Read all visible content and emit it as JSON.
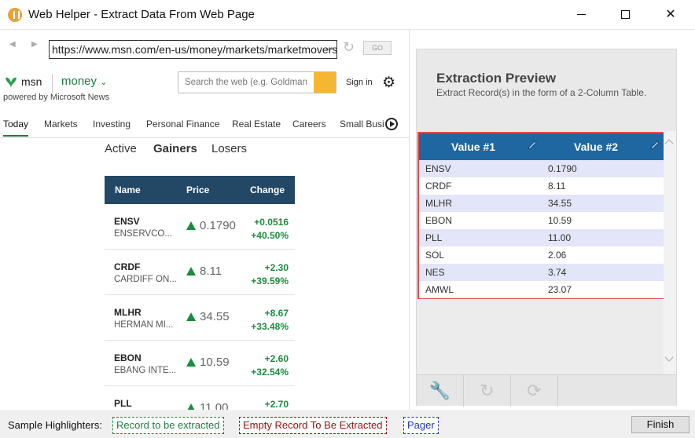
{
  "window": {
    "title": "Web Helper - Extract Data From Web Page",
    "min_label": "",
    "max_label": "",
    "close_label": "✕"
  },
  "browser": {
    "url": "https://www.msn.com/en-us/money/markets/marketmovers",
    "go_label": "GO",
    "back_icon": "left-arrow",
    "forward_icon": "right-arrow",
    "refresh_icon": "refresh"
  },
  "msn": {
    "brand": "msn",
    "section": "money",
    "powered": "powered by Microsoft News",
    "search_placeholder": "Search the web (e.g. Goldman",
    "signin": "Sign in",
    "tabs": [
      "Today",
      "Markets",
      "Investing",
      "Personal Finance",
      "Real Estate",
      "Careers",
      "Small Busi"
    ],
    "subtabs": [
      "Active",
      "Gainers",
      "Losers"
    ],
    "table": {
      "headers": [
        "Name",
        "Price",
        "Change"
      ],
      "rows": [
        {
          "symbol": "ENSV",
          "name": "ENSERVCO...",
          "price": "0.1790",
          "change": "+0.0516",
          "pct": "+40.50%"
        },
        {
          "symbol": "CRDF",
          "name": "CARDIFF ON...",
          "price": "8.11",
          "change": "+2.30",
          "pct": "+39.59%"
        },
        {
          "symbol": "MLHR",
          "name": "HERMAN MI...",
          "price": "34.55",
          "change": "+8.67",
          "pct": "+33.48%"
        },
        {
          "symbol": "EBON",
          "name": "EBANG INTE...",
          "price": "10.59",
          "change": "+2.60",
          "pct": "+32.54%"
        },
        {
          "symbol": "PLL",
          "name": "",
          "price": "11.00",
          "change": "+2.70",
          "pct": ""
        }
      ]
    }
  },
  "preview": {
    "title": "Extraction Preview",
    "subtitle": "Extract Record(s) in the form of a 2-Column Table.",
    "col1": "Value #1",
    "col2": "Value #2",
    "rows": [
      [
        "ENSV",
        "0.1790"
      ],
      [
        "CRDF",
        "8.11"
      ],
      [
        "MLHR",
        "34.55"
      ],
      [
        "EBON",
        "10.59"
      ],
      [
        "PLL",
        "11.00"
      ],
      [
        "SOL",
        "2.06"
      ],
      [
        "NES",
        "3.74"
      ],
      [
        "AMWL",
        "23.07"
      ]
    ]
  },
  "footer": {
    "label": "Sample Highlighters:",
    "record": "Record to be extracted",
    "empty": "Empty Record To Be Extracted",
    "pager": "Pager",
    "finish": "Finish"
  },
  "colors": {
    "accent_green": "#1a7d3f",
    "table_header": "#234866",
    "preview_header": "#1e67a0",
    "preview_border": "#e8474a"
  }
}
